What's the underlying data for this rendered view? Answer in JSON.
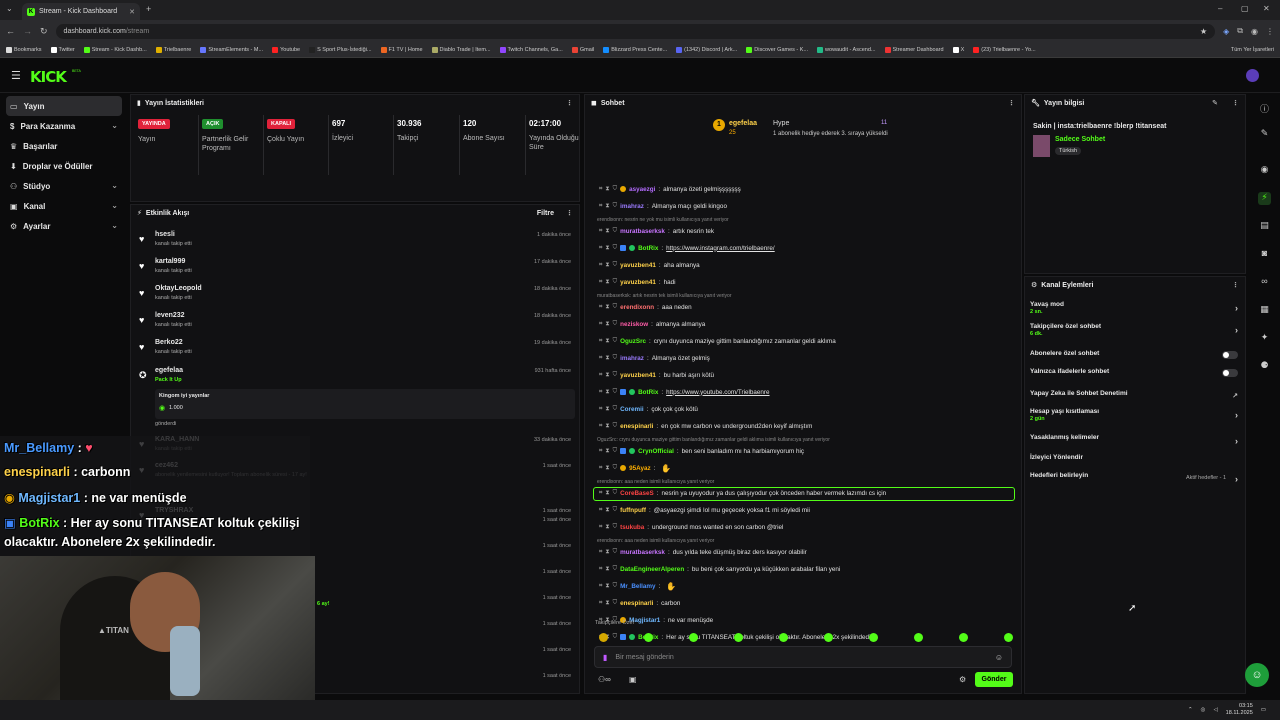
{
  "browser": {
    "tab_title": "Stream - Kick Dashboard",
    "url_host": "dashboard.kick.com",
    "url_path": "/stream",
    "all_bookmarks": "Tüm Yer İşaretleri",
    "bookmarks": [
      "Bookmarks",
      "Twitter",
      "Stream - Kick Dashb...",
      "Trielbaenre",
      "StreamElements - M...",
      "Youtube",
      "S Sport Plus-İstediği...",
      "F1 TV | Home",
      "Diablo Trade | Item...",
      "Twitch Channels, Ga...",
      "Gmail",
      "Blizzard Press Cente...",
      "(1342) Discord | Ark...",
      "Discover Games - K...",
      "wowaudit - Ascend...",
      "Streamer Dashboard",
      "X",
      "(23) Trielbaenre - Yo..."
    ]
  },
  "brand": {
    "logo": "KICK",
    "beta": "BETA"
  },
  "nav": {
    "items": [
      {
        "label": "Yayın",
        "active": true
      },
      {
        "label": "Para Kazanma",
        "chevron": true
      },
      {
        "label": "Başarılar"
      },
      {
        "label": "Droplar ve Ödüller"
      },
      {
        "label": "Stüdyo",
        "chevron": true
      },
      {
        "label": "Kanal",
        "chevron": true
      },
      {
        "label": "Ayarlar",
        "chevron": true
      }
    ]
  },
  "stats": {
    "title": "Yayın İstatistikleri",
    "cols": [
      {
        "badge": "YAYINDA",
        "badge_color": "#e0223a",
        "label": "Yayın"
      },
      {
        "badge": "AÇIK",
        "badge_color": "#1f8f2e",
        "label": "Partnerlik Gelir Programı"
      },
      {
        "badge": "KAPALI",
        "badge_color": "#e0223a",
        "label": "Çoklu Yayın"
      },
      {
        "value": "697",
        "label": "İzleyici"
      },
      {
        "value": "30.936",
        "label": "Takipçi"
      },
      {
        "value": "120",
        "label": "Abone Sayısı"
      },
      {
        "value": "02:17:00",
        "label": "Yayında Olduğu Süre"
      }
    ]
  },
  "feed": {
    "title": "Etkinlik Akışı",
    "filter": "Filtre",
    "items": [
      {
        "name": "hsesli",
        "sub": "kanalı takip etti",
        "time": "1 dakika önce"
      },
      {
        "name": "kartal999",
        "sub": "kanalı takip etti",
        "time": "17 dakika önce"
      },
      {
        "name": "OktayLeopold",
        "sub": "kanalı takip etti",
        "time": "18 dakika önce"
      },
      {
        "name": "leven232",
        "sub": "kanalı takip etti",
        "time": "18 dakika önce"
      },
      {
        "name": "Berko22",
        "sub": "kanalı takip etti",
        "time": "19 dakika önce"
      },
      {
        "name": "egefelaa",
        "sub": "Pack It Up",
        "time": "931 hafta önce",
        "detail": "Kingom iyi yayınlar",
        "amount": "1.000",
        "sent": "gönderdi"
      },
      {
        "name": "KARA_HANN",
        "sub": "kanalı takip etti",
        "time": "33 dakika önce"
      },
      {
        "name": "cez462",
        "sub": "abonelik yenilemesini kutluyor! Toplam abonelik süresi - 17 ay!",
        "time": "1 saat önce"
      },
      {
        "name": "TRYSHRAX",
        "sub": "",
        "time": "1 saat önce"
      }
    ],
    "extra_times": [
      "1 saat önce",
      "1 saat önce",
      "1 saat önce",
      "1 saat önce",
      "1 saat önce",
      "1 saat önce",
      "1 saat önce"
    ],
    "months": "6 ay!"
  },
  "chat": {
    "title": "Sohbet",
    "pinned_user": "egefelaa",
    "pinned_count": "25",
    "hype": "Hype",
    "hype_count": "11",
    "pinned_text": "1 abonelik hediye ederek 3. sıraya yükseldi",
    "messages": [
      {
        "user": "asyaezgi",
        "color": "#b46cff",
        "text": "almanya özeti gelmişşşşşşş"
      },
      {
        "user": "imahraz",
        "color": "#9b7bff",
        "text": "Almanya maçı geldi kingoo"
      },
      {
        "reply": "erendixonn: nesrin ne yok mu isimli kullanıcıya yanıt veriyor"
      },
      {
        "user": "muratbaserksk",
        "color": "#c875ff",
        "text": "artık nesrin tek"
      },
      {
        "user": "BotRix",
        "color": "#53fc18",
        "text": "https://www.instagram.com/trielbaenre/",
        "link": true
      },
      {
        "user": "yavuzben41",
        "color": "#ffd24a",
        "text": "aha almanya"
      },
      {
        "user": "yavuzben41",
        "color": "#ffd24a",
        "text": "hadi"
      },
      {
        "reply": "muratbaserksk: artık nesrin tek isimli kullanıcıya yanıt veriyor"
      },
      {
        "user": "erendixonn",
        "color": "#ff7070",
        "text": "aaa neden"
      },
      {
        "user": "neziskow",
        "color": "#ff5ca8",
        "text": "almanya almanya"
      },
      {
        "user": "OguzSrc",
        "color": "#53fc18",
        "text": "crynı duyunca maziye gittim banlandığımız zamanlar geldi aklıma"
      },
      {
        "user": "imahraz",
        "color": "#9b7bff",
        "text": "Almanya özet gelmiş"
      },
      {
        "user": "yavuzben41",
        "color": "#ffd24a",
        "text": "bu harbi aşırı kötü"
      },
      {
        "user": "BotRix",
        "color": "#53fc18",
        "text": "https://www.youtube.com/Trielbaenre",
        "link": true
      },
      {
        "user": "Coremii",
        "color": "#6fb8ff",
        "text": "çok çok çok kötü"
      },
      {
        "user": "enespinarli",
        "color": "#ffd24a",
        "text": "en çok mw carbon ve underground2den keyif almıştım"
      },
      {
        "reply": "OguzSrc: crynı duyunca maziye gittim banlandığımız zamanlar geldi aklıma isimli kullanıcıya yanıt veriyor"
      },
      {
        "user": "CrynOfficial",
        "color": "#53fc18",
        "text": "ben seni banladım mı ha harbiamıyorum hiç"
      },
      {
        "user": "95Ayaz",
        "color": "#ffb000",
        "text": ""
      },
      {
        "reply": "erendixonn: aaa neden isimli kullanıcıya yanıt veriyor"
      },
      {
        "user": "CoreBaseS",
        "color": "#ff4444",
        "text": "nesrin ya uyuyodur ya dus çalışıyodur çok önceden haber vermek lazımdı cs için"
      },
      {
        "user": "fuffnpuff",
        "color": "#ffd24a",
        "text": "@asyaezgi şimdi lol mu geçecek yoksa f1 mi söyledi mii"
      },
      {
        "user": "tsukuba",
        "color": "#ff4444",
        "text": "underground mos wanted en son carbon @triel"
      },
      {
        "reply": "erendixonn: aaa neden isimli kullanıcıya yanıt veriyor"
      },
      {
        "user": "muratbaserksk",
        "color": "#c875ff",
        "text": "dus yılda teke düşmüş biraz ders kasıyor olabilir"
      },
      {
        "user": "DataEngineerAlperen",
        "color": "#53fc18",
        "text": "bu beni çok sarıyordu ya küçükken arabalar filan yeni"
      },
      {
        "user": "Mr_Bellamy",
        "color": "#4a90ff",
        "text": ""
      },
      {
        "user": "enespinarli",
        "color": "#ffd24a",
        "text": "carbon"
      },
      {
        "user": "Magjistar1",
        "color": "#6fb8ff",
        "text": "ne var menüşde"
      },
      {
        "user": "BotRix",
        "color": "#53fc18",
        "text": "Her ay sonu TITANSEAT koltuk çekilişi olacaktır. Abonelere 2x şekilindedir."
      }
    ],
    "followers_only": "Takipçilere Özel",
    "placeholder": "Bir mesaj gönderin",
    "send": "Gönder"
  },
  "info": {
    "title": "Yayın bilgisi",
    "stream_title": "Sakin | insta:trielbaenre !blerp !titanseat",
    "category": "Sadece Sohbet",
    "tag": "Türkish"
  },
  "actions": {
    "title": "Kanal Eylemleri",
    "rows": [
      {
        "label": "Yavaş mod",
        "sub": "2 sn.",
        "kind": "chev"
      },
      {
        "label": "Takipçilere özel sohbet",
        "sub": "6 dk.",
        "kind": "chev"
      },
      {
        "label": "Abonelere özel sohbet",
        "kind": "toggle"
      },
      {
        "label": "Yalnızca ifadelerle sohbet",
        "kind": "toggle"
      },
      {
        "label": "Yapay Zeka ile Sohbet Denetimi",
        "kind": "ext"
      },
      {
        "label": "Hesap yaşı kısıtlaması",
        "sub": "2 gün",
        "kind": "chev"
      },
      {
        "label": "Yasaklanmış kelimeler",
        "kind": "chev"
      },
      {
        "label": "İzleyici Yönlendir",
        "kind": "none"
      },
      {
        "label": "Hedefleri belirleyin",
        "kind": "chev",
        "right": "Aktif hedefler - 1"
      }
    ]
  },
  "overlay": {
    "lines": [
      {
        "user": "Mr_Bellamy",
        "text": " : ",
        "color": "#4a9aff"
      },
      {
        "user": "enespinarli",
        "text": " : carbonn",
        "color": "#ffd24a"
      },
      {
        "user": "Magjistar1",
        "text": " : ne var menüşde",
        "color": "#6fb8ff"
      },
      {
        "user": "BotRix",
        "text": " : Her ay sonu TITANSEAT koltuk çekilişi olacaktır. Abonelere 2x şekilindedir.",
        "color": "#53fc18"
      }
    ]
  },
  "taskbar": {
    "time": "03:15",
    "date": "18.11.2025"
  }
}
